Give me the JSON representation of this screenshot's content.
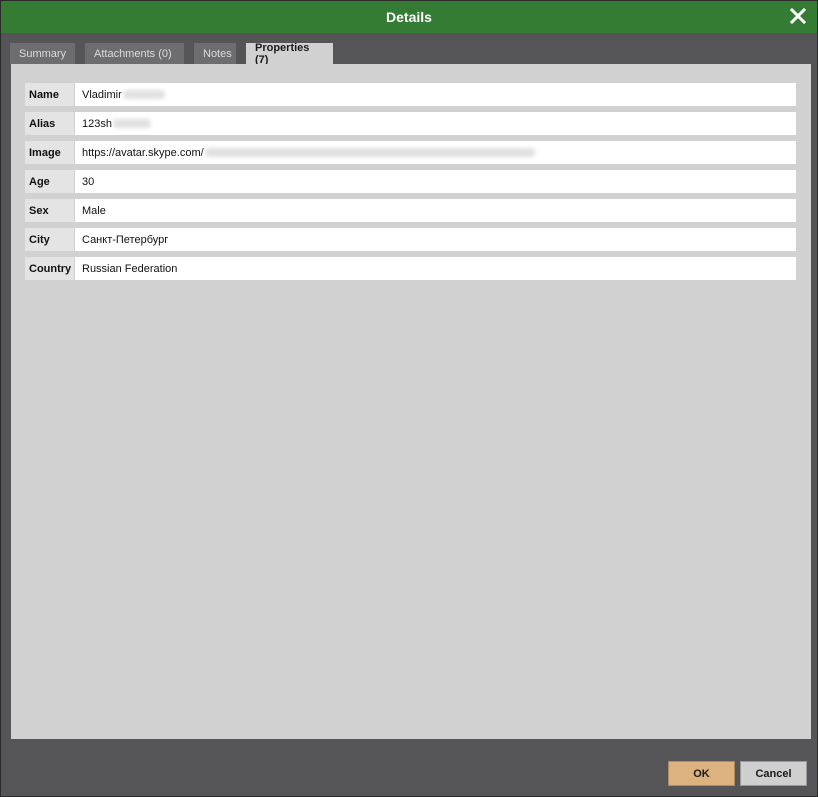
{
  "dialog": {
    "title": "Details",
    "close_icon": "close-icon"
  },
  "tabs": [
    {
      "label": "Summary",
      "active": false
    },
    {
      "label": "Attachments (0)",
      "active": false
    },
    {
      "label": "Notes",
      "active": false
    },
    {
      "label": "Properties (7)",
      "active": true
    }
  ],
  "properties": [
    {
      "key": "Name",
      "value": "Vladimir"
    },
    {
      "key": "Alias",
      "value": "123sh"
    },
    {
      "key": "Image",
      "value": "https://avatar.skype.com/"
    },
    {
      "key": "Age",
      "value": "30"
    },
    {
      "key": "Sex",
      "value": "Male"
    },
    {
      "key": "City",
      "value": "Санкт-Петербург"
    },
    {
      "key": "Country",
      "value": "Russian Federation"
    }
  ],
  "buttons": {
    "ok_label": "OK",
    "cancel_label": "Cancel"
  },
  "colors": {
    "titlebar": "#347c34",
    "ok_button": "#dcb37f"
  }
}
